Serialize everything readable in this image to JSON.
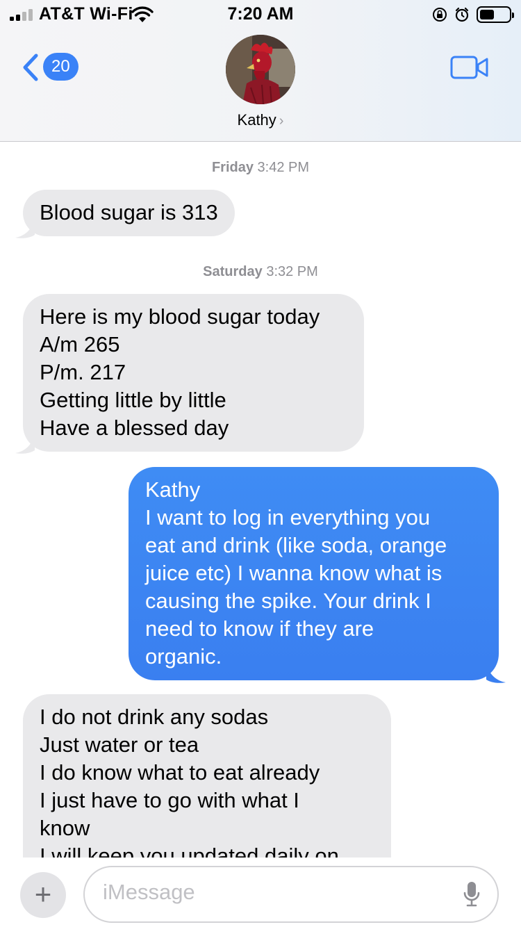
{
  "status_bar": {
    "carrier": "AT&T Wi-Fi",
    "time": "7:20 AM",
    "battery_level": 0.45,
    "icons": [
      "signal-icon",
      "wifi-icon",
      "orientation-lock-icon",
      "alarm-icon",
      "battery-icon"
    ]
  },
  "header": {
    "back_count": "20",
    "contact_name": "Kathy",
    "chevron": "›",
    "icons": [
      "back-chevron-icon",
      "video-camera-icon",
      "chevron-right-icon"
    ]
  },
  "messages": [
    {
      "type": "timestamp",
      "day": "Friday",
      "time": "3:42 PM"
    },
    {
      "type": "incoming",
      "text": "Blood sugar is 313"
    },
    {
      "type": "timestamp",
      "day": "Saturday",
      "time": "3:32 PM"
    },
    {
      "type": "incoming",
      "text": "Here is my blood sugar today\nA/m 265\nP/m. 217\nGetting little by little\nHave a blessed day"
    },
    {
      "type": "outgoing",
      "text": "Kathy\nI want to log in everything you\neat and drink (like soda, orange\njuice etc) I wanna know what is\ncausing the spike. Your drink I\nneed to know if they are\norganic."
    },
    {
      "type": "incoming",
      "text": "I do not drink any sodas\nJust water or tea\nI do know what to eat already\nI just have to go with what I\nknow\nI will keep you updated daily on"
    }
  ],
  "composer": {
    "plus": "+",
    "placeholder": "iMessage",
    "icons": [
      "plus-icon",
      "microphone-icon"
    ]
  },
  "colors": {
    "accent": "#3a82f7",
    "incoming_bubble": "#e9e9eb",
    "outgoing_bubble": "#3b85f5",
    "timestamp_text": "#8e8e93"
  }
}
